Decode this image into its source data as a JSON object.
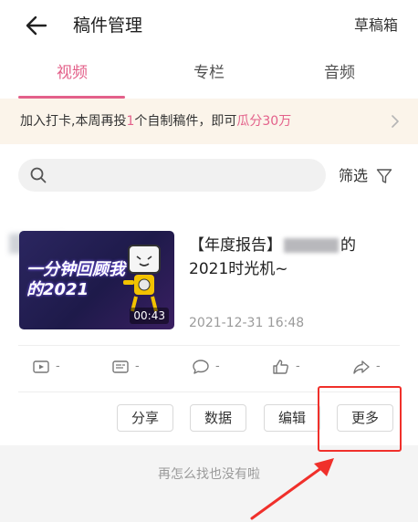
{
  "header": {
    "title": "稿件管理",
    "drafts_label": "草稿箱",
    "back_icon": "back-arrow-icon"
  },
  "tabs": [
    {
      "label": "视频",
      "active": true
    },
    {
      "label": "专栏",
      "active": false
    },
    {
      "label": "音频",
      "active": false
    }
  ],
  "banner": {
    "text_prefix": "加入打卡,本周再投",
    "highlight_count": "1",
    "text_middle": "个自制稿件，即可",
    "highlight_reward": "瓜分30万"
  },
  "search": {
    "placeholder": "",
    "filter_label": "筛选"
  },
  "video": {
    "title_prefix": "【年度报告】",
    "title_suffix": "的2021时光机~",
    "thumbnail_text": "一分钟回顾我的2021",
    "duration": "00:43",
    "date": "2021-12-31 16:48",
    "stats": {
      "plays": "-",
      "danmaku": "-",
      "comments": "-",
      "likes": "-",
      "shares": "-"
    },
    "actions": {
      "share": "分享",
      "data": "数据",
      "edit": "编辑",
      "more": "更多"
    }
  },
  "footer": {
    "end_message": "再怎么找也没有啦"
  },
  "colors": {
    "accent": "#e3608a",
    "highlight_border": "#f0302b",
    "banner_bg": "#fbf4ea"
  }
}
